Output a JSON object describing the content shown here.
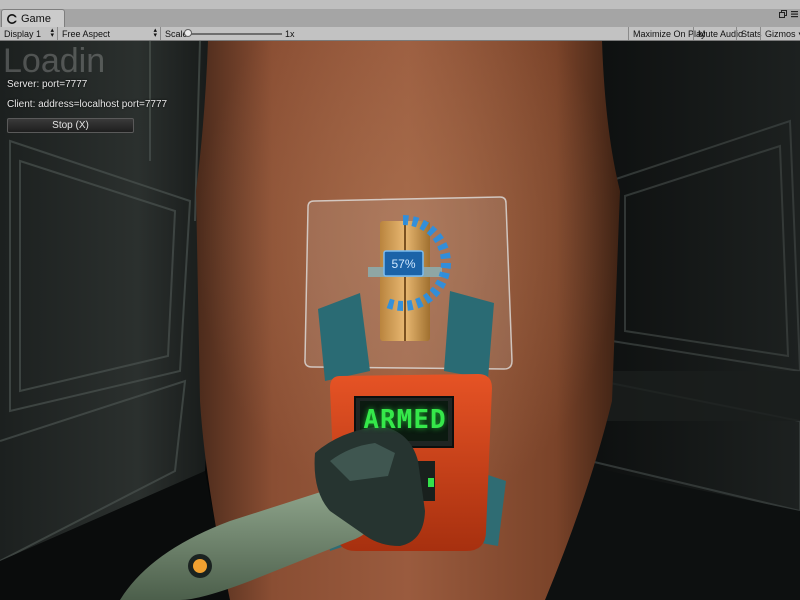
{
  "window": {
    "tab_title": "Game",
    "tab_icon": "unity-icon",
    "controls": [
      "restore-icon",
      "menu-icon"
    ]
  },
  "toolbar": {
    "display": {
      "label": "Display 1",
      "icon": "dropdown-arrow-icon"
    },
    "aspect": {
      "label": "Free Aspect",
      "icon": "dropdown-arrow-icon"
    },
    "scale": {
      "label": "Scale",
      "value_label": "1x",
      "value": 1
    },
    "maximize_on_play": "Maximize On Play",
    "mute_audio": "Mute Audio",
    "stats": "Stats",
    "gizmos": {
      "label": "Gizmos",
      "icon": "dropdown-arrow-icon"
    }
  },
  "game": {
    "loading_text": "Loadin",
    "server_text": "Server: port=7777",
    "client_text": "Client: address=localhost port=7777",
    "stop_button": "Stop (X)",
    "progress": {
      "label": "57%",
      "value": 0.57
    },
    "bomb_display": "ARMED"
  },
  "colors": {
    "editor_chrome": "#c2c2c2",
    "progress_ring": "#2b8fe0",
    "armed_text": "#35e84a",
    "bomb_body": "#d9441b"
  }
}
